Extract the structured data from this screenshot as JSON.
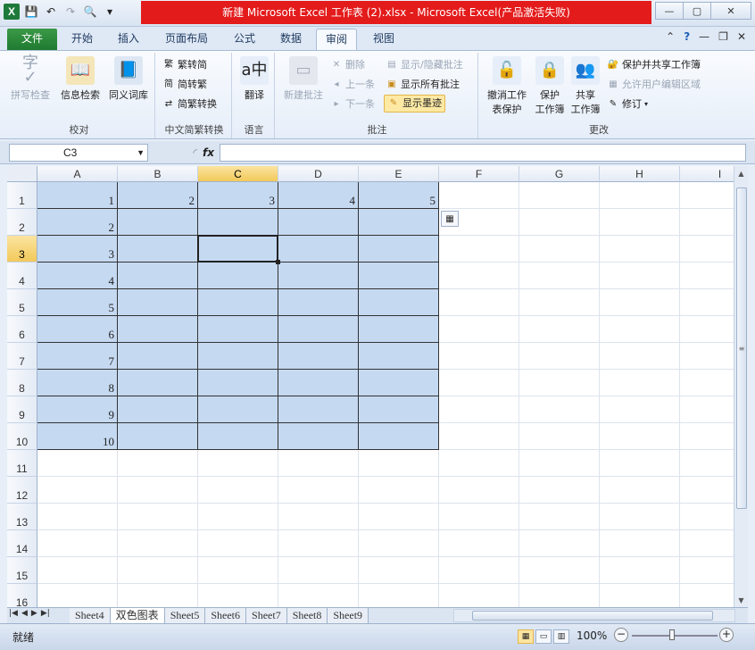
{
  "window": {
    "title": "新建 Microsoft Excel 工作表 (2).xlsx  -  Microsoft Excel(产品激活失败)",
    "minimize": "—",
    "restore": "▢",
    "close": "✕"
  },
  "tabs": [
    {
      "label": "文件"
    },
    {
      "label": "开始"
    },
    {
      "label": "插入"
    },
    {
      "label": "页面布局"
    },
    {
      "label": "公式"
    },
    {
      "label": "数据"
    },
    {
      "label": "审阅"
    },
    {
      "label": "视图"
    }
  ],
  "ribbon": {
    "proofing": {
      "label": "校对",
      "spell": "拼写检查",
      "research": "信息检索",
      "thesaurus": "同义词库"
    },
    "chinese": {
      "label": "中文简繁转换",
      "to_simplified": "繁转简",
      "to_traditional": "简转繁",
      "convert": "简繁转换"
    },
    "language": {
      "label": "语言",
      "translate": "翻译"
    },
    "comments": {
      "label": "批注",
      "new": "新建批注",
      "delete": "删除",
      "prev": "上一条",
      "next": "下一条",
      "show_hide": "显示/隐藏批注",
      "show_all": "显示所有批注",
      "show_ink": "显示墨迹"
    },
    "changes": {
      "label": "更改",
      "unprotect_sheet_1": "撤消工作",
      "unprotect_sheet_2": "表保护",
      "protect_wb_1": "保护",
      "protect_wb_2": "工作簿",
      "share_wb_1": "共享",
      "share_wb_2": "工作簿",
      "protect_share": "保护并共享工作簿",
      "allow_edit": "允许用户编辑区域",
      "track": "修订"
    }
  },
  "formula_bar": {
    "name_box": "C3",
    "fx": "fx",
    "value": ""
  },
  "columns": [
    "A",
    "B",
    "C",
    "D",
    "E",
    "F",
    "G",
    "H",
    "I"
  ],
  "rows": [
    "1",
    "2",
    "3",
    "4",
    "5",
    "6",
    "7",
    "8",
    "9",
    "10",
    "11",
    "12",
    "13",
    "14",
    "15",
    "16"
  ],
  "cells": {
    "A1": "1",
    "B1": "2",
    "C1": "3",
    "D1": "4",
    "E1": "5",
    "A2": "2",
    "A3": "3",
    "A4": "4",
    "A5": "5",
    "A6": "6",
    "A7": "7",
    "A8": "8",
    "A9": "9",
    "A10": "10"
  },
  "selection": {
    "active": "C3",
    "fill_range": "A1:E10",
    "fill_color": "#c5d9f1"
  },
  "sheets": [
    {
      "label": "Sheet4"
    },
    {
      "label": "双色图表"
    },
    {
      "label": "Sheet5"
    },
    {
      "label": "Sheet6"
    },
    {
      "label": "Sheet7"
    },
    {
      "label": "Sheet8"
    },
    {
      "label": "Sheet9"
    }
  ],
  "status": {
    "ready": "就绪",
    "zoom": "100%"
  }
}
